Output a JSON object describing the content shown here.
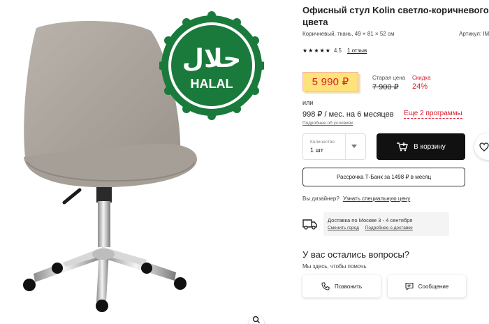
{
  "product": {
    "title": "Офисный стул Kolin светло-коричневого цвета",
    "specs": "Коричневый, ткань, 49 × 81 × 52 см",
    "sku_label": "Артикул: IMR",
    "rating": 5,
    "rating_score": "4.5",
    "reviews_link": "1 отзыв"
  },
  "badge": {
    "arabic": "حلال",
    "text": "HALAL"
  },
  "pricing": {
    "price": "5 990 ₽",
    "old_price_label": "Старая цена",
    "old_price": "7 900 ₽",
    "discount_label": "Скидка",
    "discount": "24%",
    "or_label": "или",
    "installment": "998 ₽ / мес. на 6 месяцев",
    "more_programs": "Еще 2 программы",
    "conditions_link": "Подробнее об условиях"
  },
  "purchase": {
    "quantity_label": "Количество",
    "quantity_value": "1 шт",
    "cart_button": "В корзину",
    "credit_button": "Рассрочка Т-Банк за 1498 ₽ в месяц"
  },
  "designer": {
    "question": "Вы дизайнер?",
    "link": "Узнать специальную цену"
  },
  "delivery": {
    "text": "Доставка по Москве 3 - 4 сентября",
    "change_city": "Сменить город",
    "details": "Подробнее о доставке"
  },
  "support": {
    "title": "У вас остались вопросы?",
    "subtitle": "Мы здесь, чтобы помочь",
    "call_button": "Позвонить",
    "message_button": "Сообщение"
  },
  "colors": {
    "accent_red": "#d81b2b",
    "price_bg": "#ffe37a",
    "halal_green": "#1a7a3c",
    "button_dark": "#111111"
  }
}
